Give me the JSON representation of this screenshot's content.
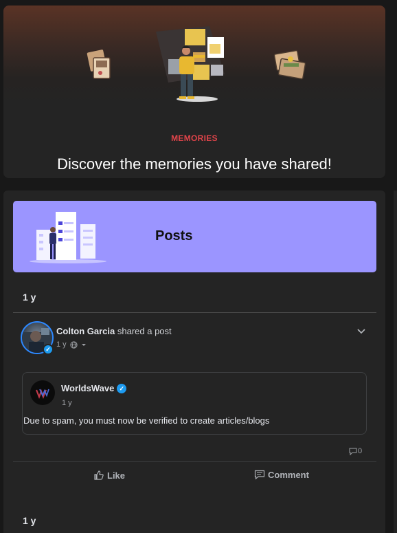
{
  "hero": {
    "kicker": "MEMORIES",
    "title": "Discover the memories you have shared!"
  },
  "posts_section": {
    "title": "Posts",
    "groups": [
      {
        "time_label": "1 y",
        "post": {
          "author": "Colton Garcia",
          "action": "shared a post",
          "time": "1 y",
          "privacy_icon": "globe-icon",
          "shared": {
            "page_name": "WorldsWave",
            "verified": true,
            "time": "1 y",
            "text": "Due to spam, you must now be verified to create articles/blogs"
          },
          "comment_count": "0",
          "actions": {
            "like": "Like",
            "comment": "Comment"
          }
        }
      },
      {
        "time_label": "1 y"
      }
    ]
  },
  "colors": {
    "accent_red": "#e0444a",
    "banner_purple": "#9b95ff",
    "verified_blue": "#1d9bf0",
    "panel": "#242424"
  }
}
